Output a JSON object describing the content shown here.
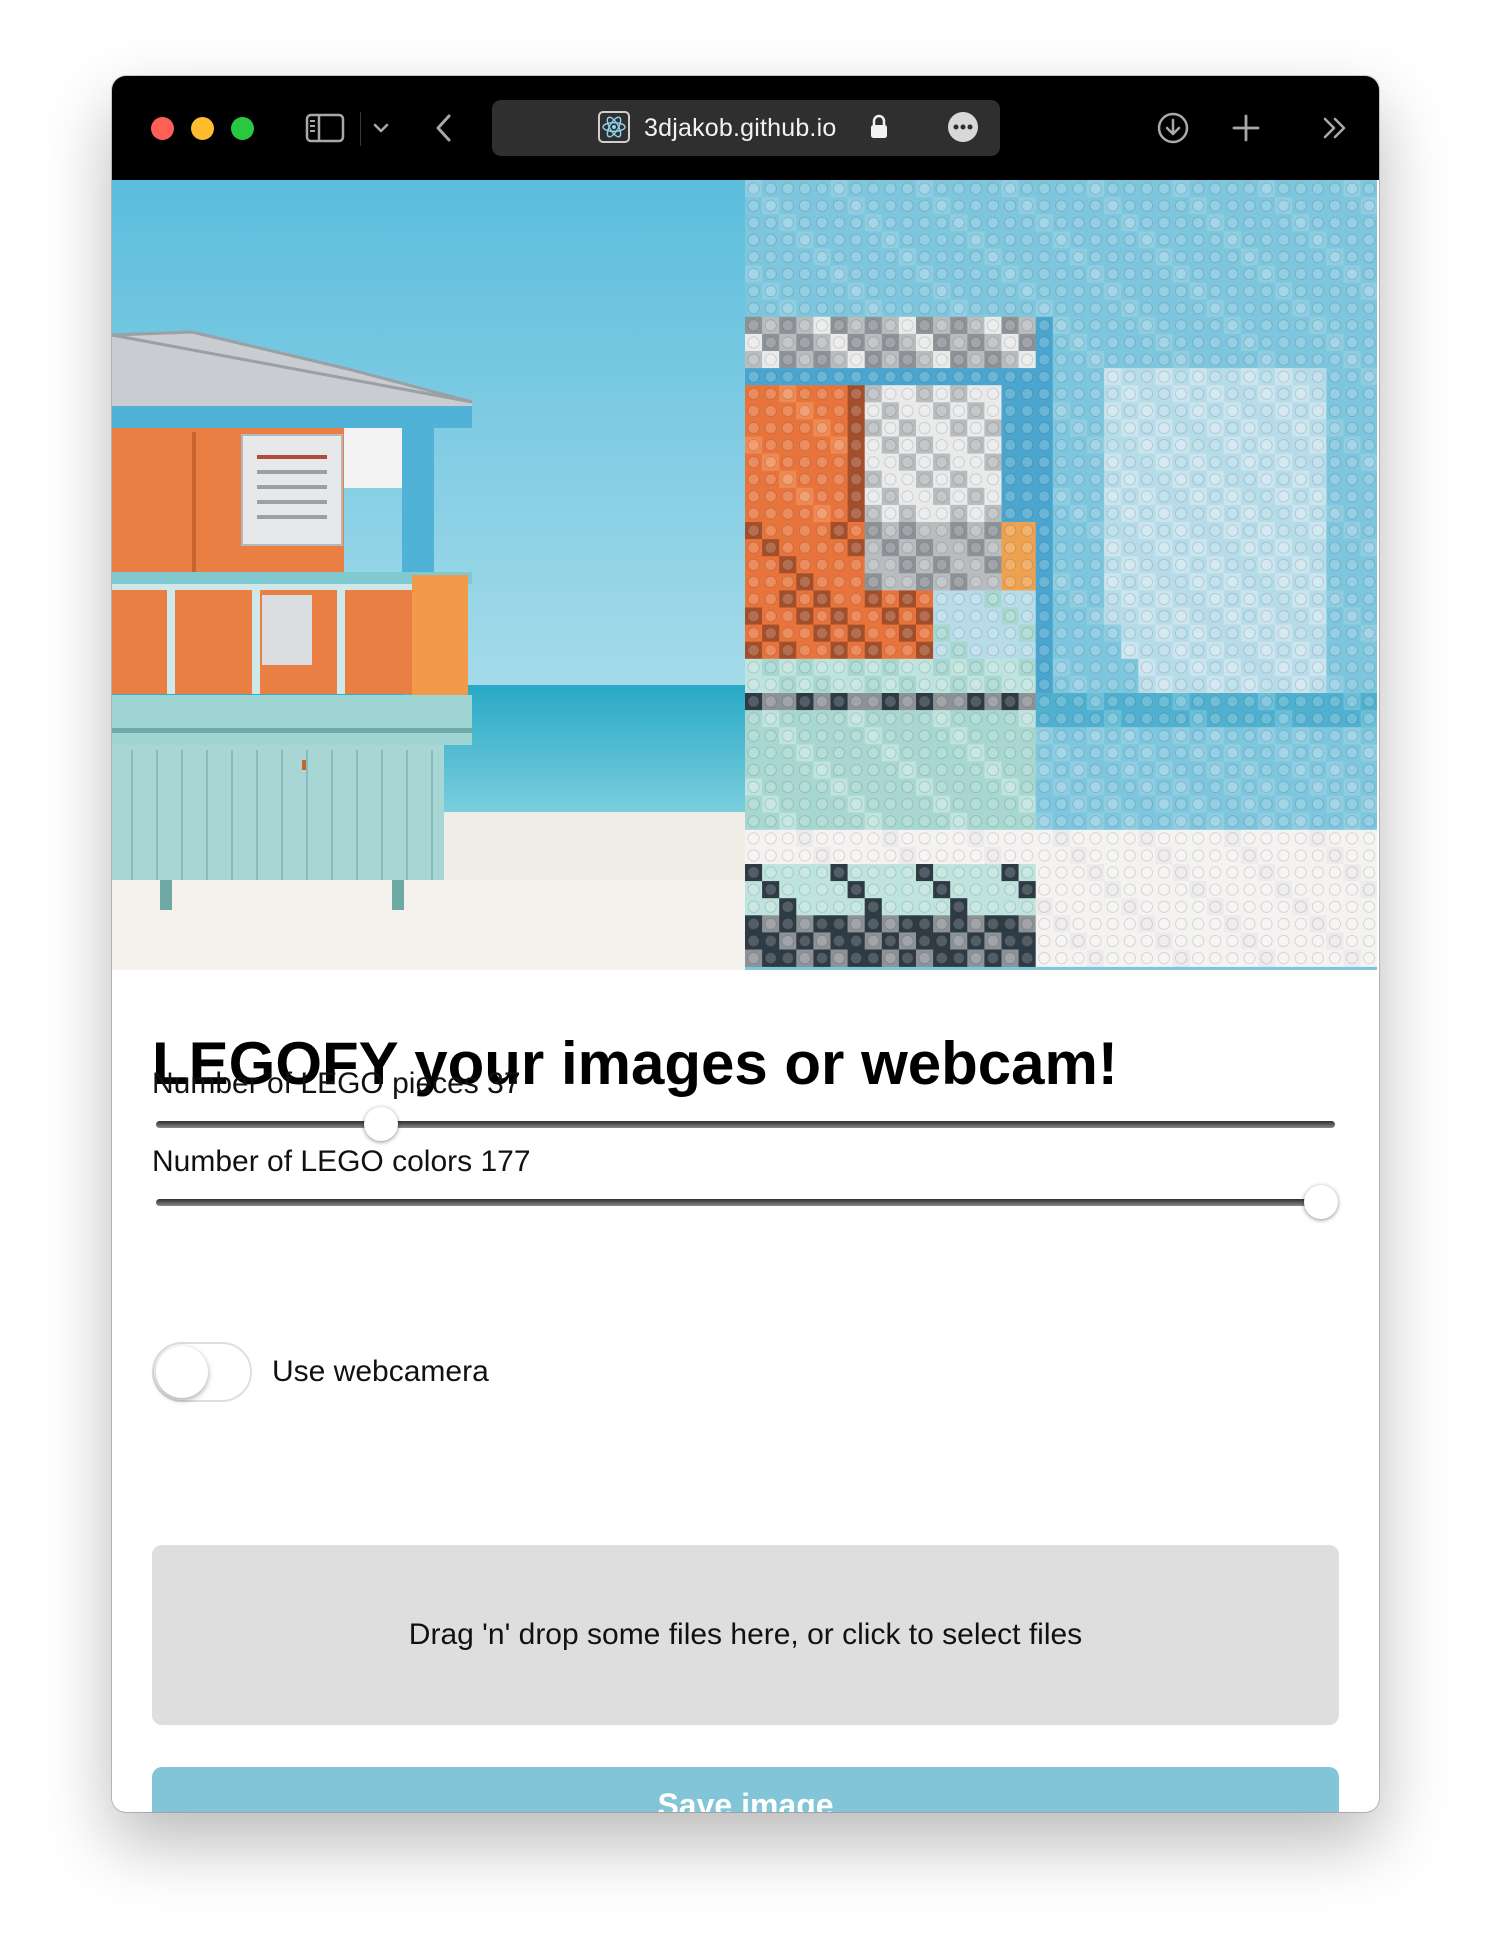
{
  "browser": {
    "url": "3djakob.github.io",
    "icons": [
      "sidebar-icon",
      "chevron-down-icon",
      "back-icon",
      "react-favicon",
      "lock-icon",
      "more-icon",
      "download-icon",
      "new-tab-icon",
      "overflow-icon"
    ]
  },
  "hero": {
    "left_image": "beach lifeguard tower photo",
    "right_image": "legofied version of the photo"
  },
  "page": {
    "title": "LEGOFY your images or webcam!",
    "pieces": {
      "label": "Number of LEGO pieces 37",
      "value": 37,
      "level": 0.19
    },
    "colors": {
      "label": "Number of LEGO colors 177",
      "value": 177,
      "level": 0.99
    },
    "webcam": {
      "label": "Use webcamera",
      "on": false
    },
    "dropzone": {
      "text": "Drag 'n' drop some files here, or click to select files"
    },
    "save_button": "Save image"
  },
  "colors": {
    "accent": "#82c5d9",
    "dropzone_bg": "#dedede",
    "titlebar_bg": "#000000",
    "sky": "#6ec8e2",
    "lego_orange": "#e8743c"
  }
}
